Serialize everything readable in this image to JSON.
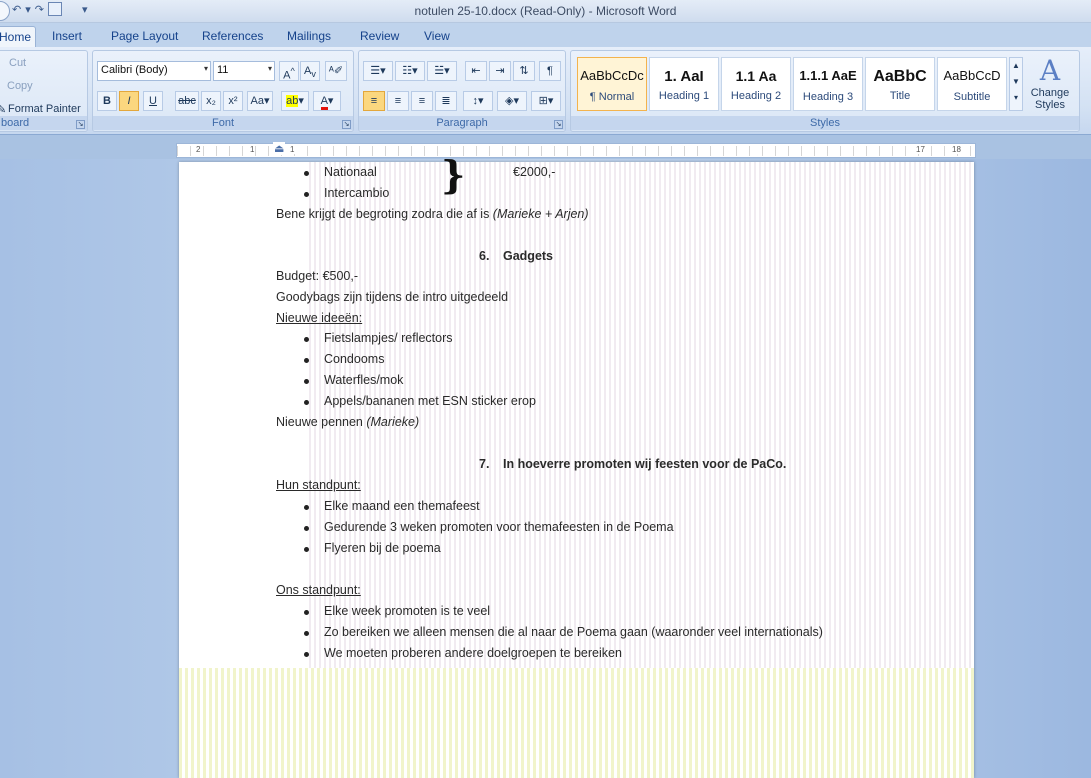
{
  "window": {
    "title": "notulen 25-10.docx (Read-Only) - Microsoft Word"
  },
  "tabs": [
    {
      "label": "Home"
    },
    {
      "label": "Insert"
    },
    {
      "label": "Page Layout"
    },
    {
      "label": "References"
    },
    {
      "label": "Mailings"
    },
    {
      "label": "Review"
    },
    {
      "label": "View"
    }
  ],
  "clipboard": {
    "cut": "Cut",
    "copy": "Copy",
    "format_painter": "Format Painter",
    "label": "board"
  },
  "font": {
    "name": "Calibri (Body)",
    "size": "11",
    "label": "Font"
  },
  "paragraph": {
    "label": "Paragraph"
  },
  "styles": {
    "label": "Styles",
    "items": [
      {
        "sample": "AaBbCcDc",
        "name": "¶ Normal"
      },
      {
        "sample": "1. AaI",
        "name": "Heading 1"
      },
      {
        "sample": "1.1 Aa",
        "name": "Heading 2"
      },
      {
        "sample": "1.1.1 AaE",
        "name": "Heading 3"
      },
      {
        "sample": "AaBbC",
        "name": "Title"
      },
      {
        "sample": "AaBbCcD",
        "name": "Subtitle"
      }
    ],
    "change_styles": "Change Styles"
  },
  "ruler": {
    "labels": [
      "2",
      "1",
      "1",
      "17",
      "18"
    ]
  },
  "document": {
    "lines": {
      "b1": "Nationaal",
      "amount": "€2000,-",
      "b2": "Intercambio",
      "p1a": "Bene krijgt de begroting zodra die af is ",
      "p1b": "(Marieke + Arjen)",
      "h6num": "6.",
      "h6": "Gadgets",
      "p2": "Budget: €500,-",
      "p3": "Goodybags zijn tijdens de intro uitgedeeld",
      "p4": "Nieuwe ideeën:",
      "b3": "Fietslampjes/ reflectors",
      "b4": "Condooms",
      "b5": "Waterfles/mok",
      "b6": "Appels/bananen met ESN sticker erop",
      "p5a": "Nieuwe pennen ",
      "p5b": "(Marieke)",
      "h7num": "7.",
      "h7": "In hoeverre promoten wij feesten voor de PaCo.",
      "p6": "Hun standpunt:",
      "b7": "Elke maand een themafeest",
      "b8": "Gedurende 3 weken promoten voor themafeesten in de Poema",
      "b9": "Flyeren bij de poema",
      "p7": "Ons standpunt:",
      "b10": "Elke week promoten is te veel",
      "b11": "Zo bereiken we alleen mensen die al naar de Poema gaan (waaronder veel internationals)",
      "b12": "We moeten proberen andere doelgroepen te bereiken"
    }
  },
  "colors": {
    "ribbon_bg": "#d3e1f3",
    "accent": "#15428b",
    "highlight_style": "#f3b34e"
  }
}
